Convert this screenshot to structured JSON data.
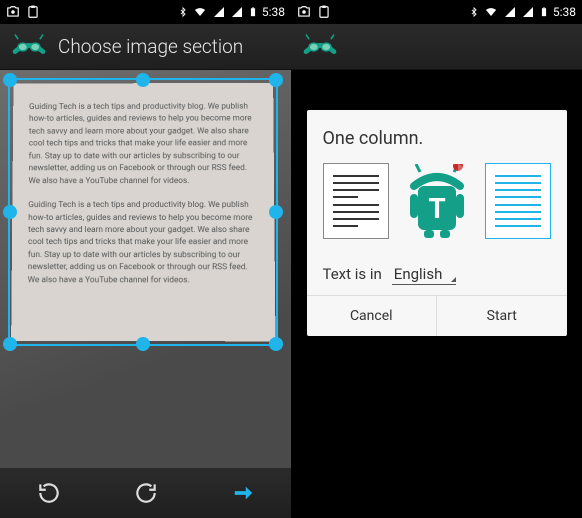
{
  "statusbar": {
    "clock": "5:38"
  },
  "left": {
    "header_title": "Choose image section",
    "document_p1": "Guiding Tech is a tech tips and productivity blog. We publish how-to articles, guides and reviews to help you become more tech savvy and learn more about your gadget. We also share cool tech tips and tricks that make your life easier and more fun. Stay up to date with our articles by subscribing to our newsletter, adding us on Facebook or through our RSS feed. We also have a YouTube channel for videos.",
    "document_p2": "Guiding Tech is a tech tips and productivity blog. We publish how-to articles, guides and reviews to help you become more tech savvy and learn more about your gadget. We also share cool tech tips and tricks that make your life easier and more fun. Stay up to date with our articles by subscribing to our newsletter, adding us on Facebook or through our RSS feed. We also have a YouTube channel for videos."
  },
  "right": {
    "dialog_title": "One column.",
    "lang_label": "Text is in",
    "lang_value": "English",
    "cancel_label": "Cancel",
    "start_label": "Start"
  }
}
